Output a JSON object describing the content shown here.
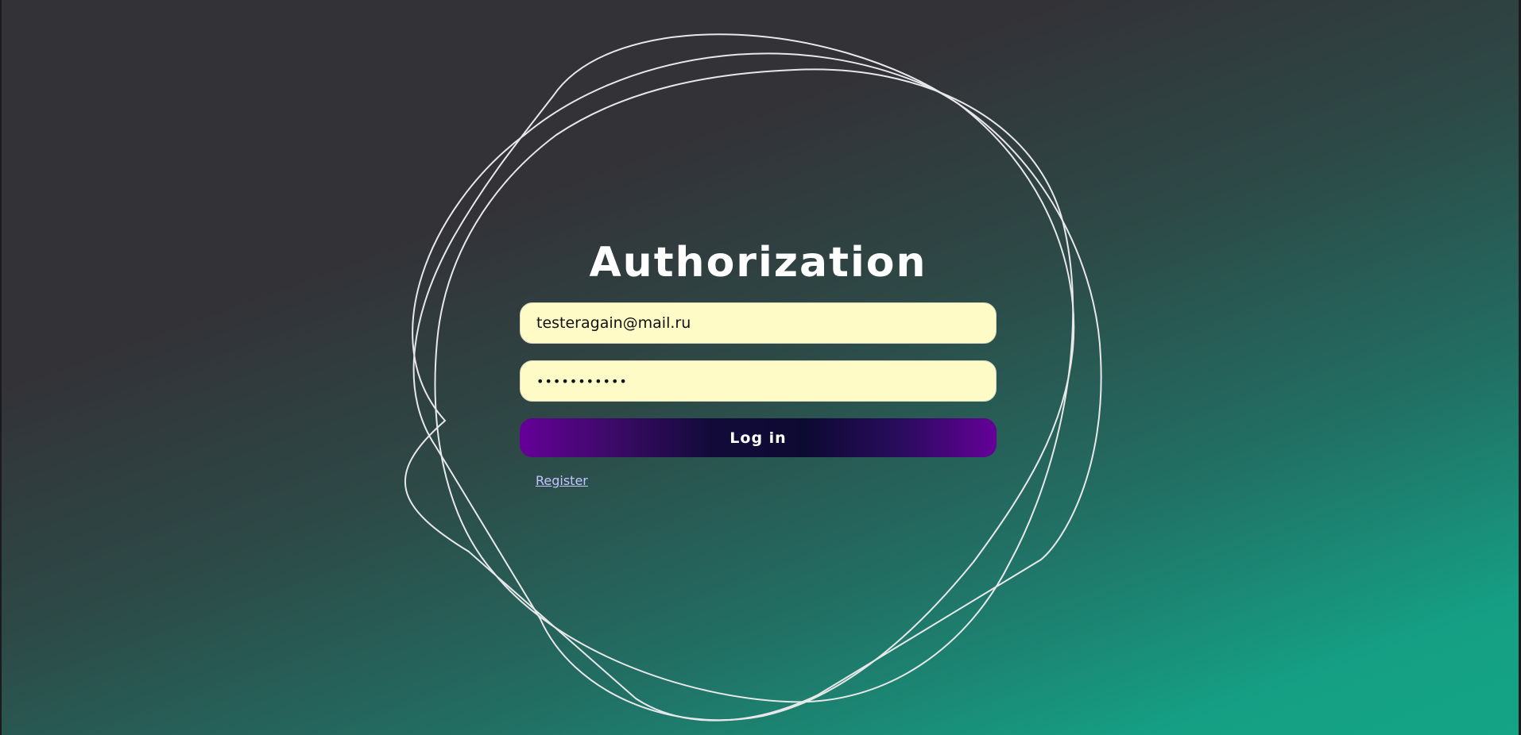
{
  "page": {
    "title": "Authorization"
  },
  "form": {
    "email_value": "testeragain@mail.ru",
    "password_masked": "•••••••••••",
    "login_label": "Log in",
    "register_label": "Register"
  },
  "colors": {
    "background_top": "#333237",
    "background_bottom": "#14a585",
    "input_background": "#fffbc6",
    "button_edge": "#650099",
    "button_center": "#0d0a32",
    "link": "#c8c2ff",
    "rings": "#e8e8ea"
  }
}
